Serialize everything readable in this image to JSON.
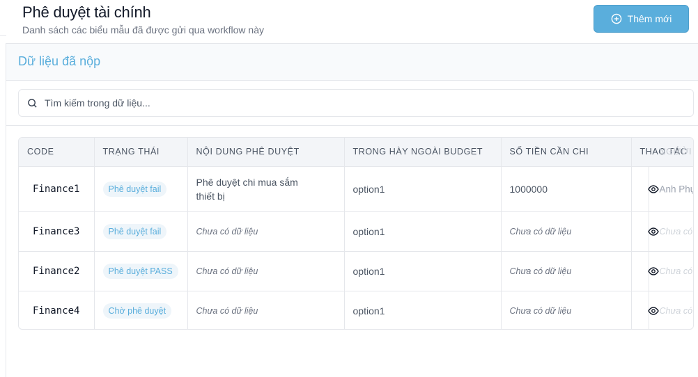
{
  "header": {
    "title": "Phê duyệt tài chính",
    "subtitle": "Danh sách các biểu mẫu đã được gửi qua workflow này",
    "add_button_label": "Thêm mới"
  },
  "card": {
    "title": "Dữ liệu đã nộp",
    "search_placeholder": "Tìm kiếm trong dữ liệu..."
  },
  "table": {
    "columns": [
      "CODE",
      "TRẠNG THÁI",
      "NỘI DUNG PHÊ DUYỆT",
      "TRONG HÀY NGOÀI BUDGET",
      "SỐ TIỀN CẦN CHI",
      "THAO TÁC",
      "NGƯỜI"
    ],
    "rows": [
      {
        "code": "Finance1",
        "status": "Phê duyệt fail",
        "content": "Phê duyệt chi mua sắm thiết bị",
        "budget": "option1",
        "amount": "1000000",
        "creator": "Anh Phụ"
      },
      {
        "code": "Finance3",
        "status": "Phê duyệt fail",
        "content": "Chưa có dữ liệu",
        "budget": "option1",
        "amount": "Chưa có dữ liệu",
        "creator": "Chưa có"
      },
      {
        "code": "Finance2",
        "status": "Phê duyệt PASS",
        "content": "Chưa có dữ liệu",
        "budget": "option1",
        "amount": "Chưa có dữ liệu",
        "creator": "Chưa có"
      },
      {
        "code": "Finance4",
        "status": "Chờ phê duyệt",
        "content": "Chưa có dữ liệu",
        "budget": "option1",
        "amount": "Chưa có dữ liệu",
        "creator": "Chưa có"
      }
    ]
  },
  "colors": {
    "accent": "#5aaedc",
    "badge_bg": "#eef5fa"
  },
  "icons": {
    "add": "plus-circle-icon",
    "search": "search-icon",
    "view": "eye-icon"
  }
}
